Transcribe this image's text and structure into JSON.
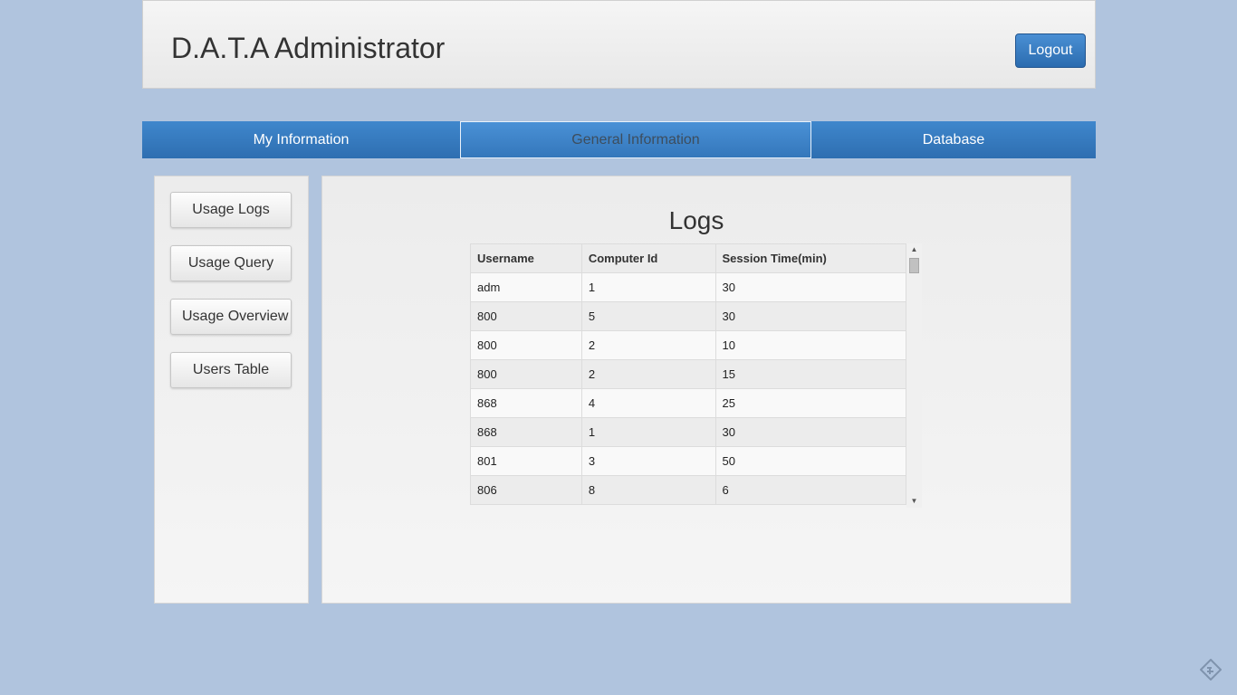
{
  "header": {
    "title": "D.A.T.A Administrator",
    "logout_label": "Logout"
  },
  "tabs": [
    {
      "label": "My Information"
    },
    {
      "label": "General Information"
    },
    {
      "label": "Database"
    }
  ],
  "sidebar": {
    "items": [
      {
        "label": "Usage Logs"
      },
      {
        "label": "Usage Query"
      },
      {
        "label": "Usage Overview"
      },
      {
        "label": "Users Table"
      }
    ]
  },
  "main": {
    "title": "Logs",
    "table": {
      "columns": [
        "Username",
        "Computer Id",
        "Session Time(min)"
      ],
      "rows": [
        [
          "adm",
          "1",
          "30"
        ],
        [
          "800",
          "5",
          "30"
        ],
        [
          "800",
          "2",
          "10"
        ],
        [
          "800",
          "2",
          "15"
        ],
        [
          "868",
          "4",
          "25"
        ],
        [
          "868",
          "1",
          "30"
        ],
        [
          "801",
          "3",
          "50"
        ],
        [
          "806",
          "8",
          "6"
        ]
      ]
    }
  },
  "icons": {
    "scroll_up": "arrow-up-icon",
    "scroll_down": "arrow-down-icon",
    "corner": "app-logo-icon"
  },
  "colors": {
    "background": "#b0c4de",
    "tab_blue": "#3a7fc4",
    "button_blue": "#2b6cb0"
  }
}
